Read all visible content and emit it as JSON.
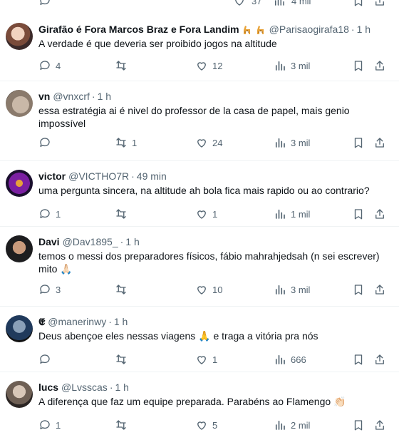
{
  "top_strip": {
    "reply_count": "",
    "like_count": "37",
    "views": "4 mil"
  },
  "tweets": [
    {
      "name": "Girafão é Fora Marcos Braz e Fora Landim",
      "emoji": "giraffe-emoji",
      "handle": "@Parisaogirafa18",
      "time": "1 h",
      "text": "A verdade é que deveria ser proibido jogos na altitude",
      "replies": "4",
      "retweets": "",
      "likes": "12",
      "views": "3 mil"
    },
    {
      "name": "vn",
      "handle": "@vnxcrf",
      "time": "1 h",
      "text": "essa estratégia ai é nivel do professor de la casa de papel, mais genio impossível",
      "replies": "",
      "retweets": "1",
      "likes": "24",
      "views": "3 mil"
    },
    {
      "name": "victor",
      "handle": "@VICTHO7R",
      "time": "49 min",
      "text": "uma pergunta sincera, na altitude ah bola fica mais rapido ou ao contrario?",
      "replies": "1",
      "retweets": "",
      "likes": "1",
      "views": "1 mil"
    },
    {
      "name": "Davi",
      "handle": "@Dav1895_",
      "time": "1 h",
      "text": "temos o messi dos preparadores físicos, fábio mahrahjedsah (n sei escrever) mito 🙏🏻",
      "replies": "3",
      "retweets": "",
      "likes": "10",
      "views": "3 mil"
    },
    {
      "name": "𝕰",
      "handle": "@manerinwy",
      "time": "1 h",
      "text": "Deus abençoe eles nessas viagens 🙏 e traga a vitória pra nós",
      "replies": "",
      "retweets": "",
      "likes": "1",
      "views": "666"
    },
    {
      "name": "lucs",
      "handle": "@Lvsscas",
      "time": "1 h",
      "text": "A diferença que faz um equipe preparada. Parabéns ao Flamengo 👏🏻",
      "replies": "1",
      "retweets": "",
      "likes": "5",
      "views": "2 mil"
    }
  ],
  "colors": {
    "muted": "#536471",
    "text": "#0f1419",
    "divider": "#eff3f4"
  }
}
